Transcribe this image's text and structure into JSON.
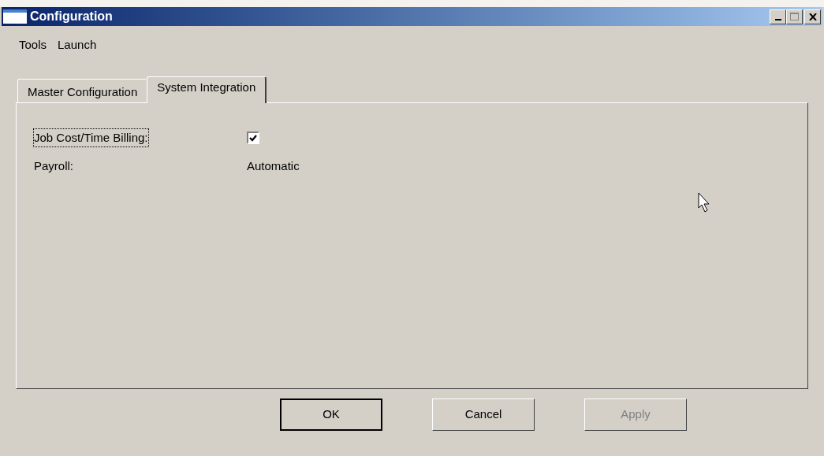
{
  "window": {
    "title": "Configuration"
  },
  "menu": [
    "Tools",
    "Launch"
  ],
  "tabs": [
    {
      "label": "Master Configuration",
      "selected": false
    },
    {
      "label": "System Integration",
      "selected": true
    }
  ],
  "fields": [
    {
      "kind": "checkbox",
      "label": "Job Cost/Time Billing:",
      "checked": true,
      "focused": true
    },
    {
      "kind": "text",
      "label": "Payroll:",
      "value": "Automatic"
    }
  ],
  "buttons": [
    {
      "label": "OK",
      "default": true,
      "disabled": false
    },
    {
      "label": "Cancel",
      "default": false,
      "disabled": false
    },
    {
      "label": "Apply",
      "default": false,
      "disabled": true
    }
  ]
}
